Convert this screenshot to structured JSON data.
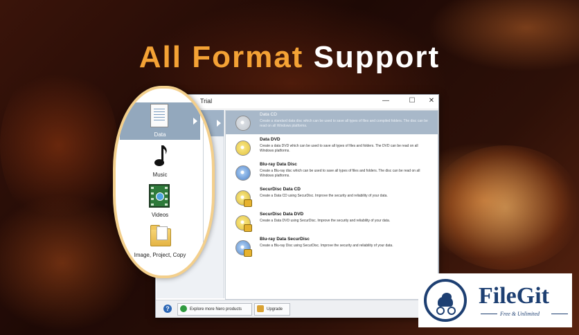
{
  "headline": {
    "part1": "All Format",
    "part2": "Support"
  },
  "window": {
    "title": "Trial",
    "controls": {
      "minimize": "—",
      "maximize": "☐",
      "close": "✕"
    },
    "categories": [
      {
        "label": "Data"
      },
      {
        "label": "Music"
      },
      {
        "label": "Videos"
      },
      {
        "label": "Image, Project, Copy"
      }
    ],
    "items": [
      {
        "title": "Data CD",
        "desc": "Create a standard data disc which can be used to save all types of files and compiled folders. The disc can be read on all Windows platforms."
      },
      {
        "title": "Data DVD",
        "desc": "Create a data DVD which can be used to save all types of files and folders. The DVD can be read on all Windows platforms."
      },
      {
        "title": "Blu-ray Data Disc",
        "desc": "Create a Blu-ray disc which can be used to save all types of files and folders. The disc can be read on all Windows platforms."
      },
      {
        "title": "SecurDisc Data CD",
        "desc": "Create a Data CD using SecurDisc. Improve the security and reliability of your data."
      },
      {
        "title": "SecurDisc Data DVD",
        "desc": "Create a Data DVD using SecurDisc. Improve the security and reliability of your data."
      },
      {
        "title": "Blu-ray Data SecurDisc",
        "desc": "Create a Blu-ray Disc using SecurDisc. Improve the security and reliability of your data."
      }
    ],
    "bottom": {
      "help": "?",
      "explore": "Explore more Nero products",
      "upgrade": "Upgrade"
    }
  },
  "logo": {
    "name": "FileGit",
    "tagline": "Free & Unlimited",
    "color": "#1d3f72"
  }
}
